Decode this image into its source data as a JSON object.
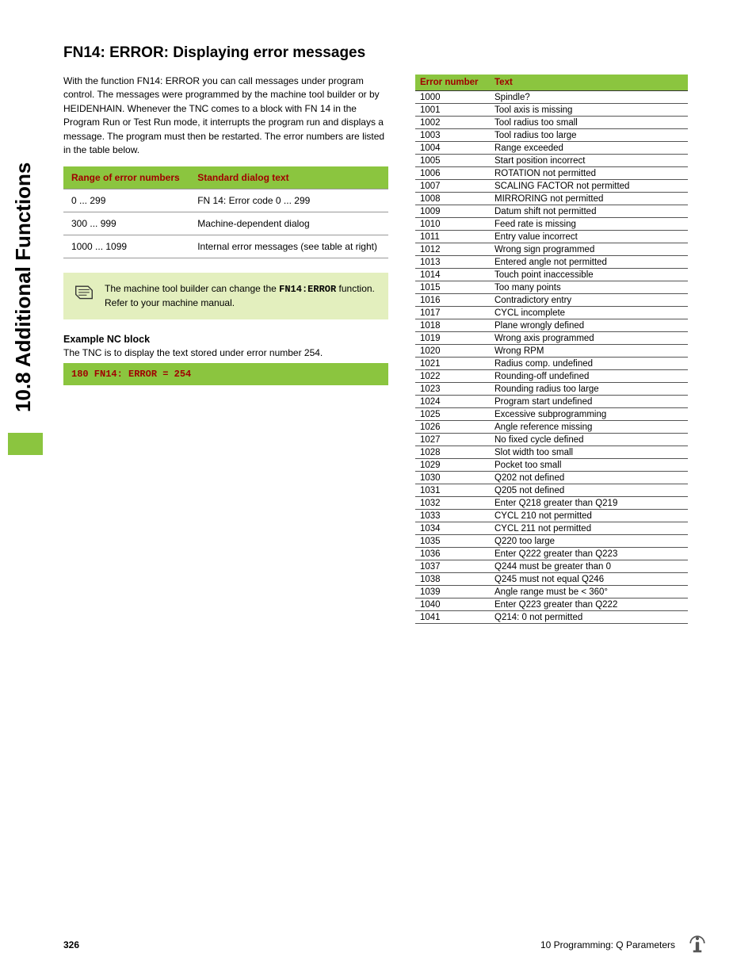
{
  "section_tab": "10.8 Additional Functions",
  "heading": "FN14: ERROR: Displaying error messages",
  "intro": "With the function FN14: ERROR you can call messages under program control. The messages were programmed by the machine tool builder or by HEIDENHAIN. Whenever the TNC comes to a block with FN 14 in the Program Run or Test Run mode, it interrupts the program run and displays a message. The program must then be restarted. The error numbers are listed in the table below.",
  "range_table": {
    "headers": [
      "Range of error numbers",
      "Standard dialog text"
    ],
    "rows": [
      [
        "0 ... 299",
        "FN 14: Error code 0 ... 299"
      ],
      [
        "300 ... 999",
        "Machine-dependent dialog"
      ],
      [
        "1000 ... 1099",
        "Internal error messages (see table at right)"
      ]
    ]
  },
  "note": {
    "pre": "The machine tool builder can change the ",
    "code": "FN14:ERROR",
    "post": " function. Refer to your machine manual."
  },
  "example": {
    "title": "Example NC block",
    "desc": "The TNC is to display the text stored under error number 254.",
    "code": "180 FN14: ERROR = 254"
  },
  "error_table": {
    "headers": [
      "Error number",
      "Text"
    ],
    "rows": [
      [
        "1000",
        "Spindle?"
      ],
      [
        "1001",
        "Tool axis is missing"
      ],
      [
        "1002",
        "Tool radius too small"
      ],
      [
        "1003",
        "Tool radius too large"
      ],
      [
        "1004",
        "Range exceeded"
      ],
      [
        "1005",
        "Start position incorrect"
      ],
      [
        "1006",
        "ROTATION not permitted"
      ],
      [
        "1007",
        "SCALING FACTOR not permitted"
      ],
      [
        "1008",
        "MIRRORING not permitted"
      ],
      [
        "1009",
        "Datum shift not permitted"
      ],
      [
        "1010",
        "Feed rate is missing"
      ],
      [
        "1011",
        "Entry value incorrect"
      ],
      [
        "1012",
        "Wrong sign programmed"
      ],
      [
        "1013",
        "Entered angle not permitted"
      ],
      [
        "1014",
        "Touch point inaccessible"
      ],
      [
        "1015",
        "Too many points"
      ],
      [
        "1016",
        "Contradictory entry"
      ],
      [
        "1017",
        "CYCL incomplete"
      ],
      [
        "1018",
        "Plane wrongly defined"
      ],
      [
        "1019",
        "Wrong axis programmed"
      ],
      [
        "1020",
        "Wrong RPM"
      ],
      [
        "1021",
        "Radius comp. undefined"
      ],
      [
        "1022",
        "Rounding-off undefined"
      ],
      [
        "1023",
        "Rounding radius too large"
      ],
      [
        "1024",
        "Program start undefined"
      ],
      [
        "1025",
        "Excessive subprogramming"
      ],
      [
        "1026",
        "Angle reference missing"
      ],
      [
        "1027",
        "No fixed cycle defined"
      ],
      [
        "1028",
        "Slot width too small"
      ],
      [
        "1029",
        "Pocket too small"
      ],
      [
        "1030",
        "Q202 not defined"
      ],
      [
        "1031",
        "Q205 not defined"
      ],
      [
        "1032",
        "Enter Q218 greater than Q219"
      ],
      [
        "1033",
        "CYCL 210 not permitted"
      ],
      [
        "1034",
        "CYCL 211 not permitted"
      ],
      [
        "1035",
        "Q220 too large"
      ],
      [
        "1036",
        "Enter Q222 greater than Q223"
      ],
      [
        "1037",
        "Q244 must be greater than 0"
      ],
      [
        "1038",
        "Q245 must not equal Q246"
      ],
      [
        "1039",
        "Angle range must be < 360°"
      ],
      [
        "1040",
        "Enter Q223 greater than Q222"
      ],
      [
        "1041",
        "Q214: 0 not permitted"
      ]
    ]
  },
  "footer": {
    "page": "326",
    "chapter": "10 Programming: Q Parameters"
  }
}
